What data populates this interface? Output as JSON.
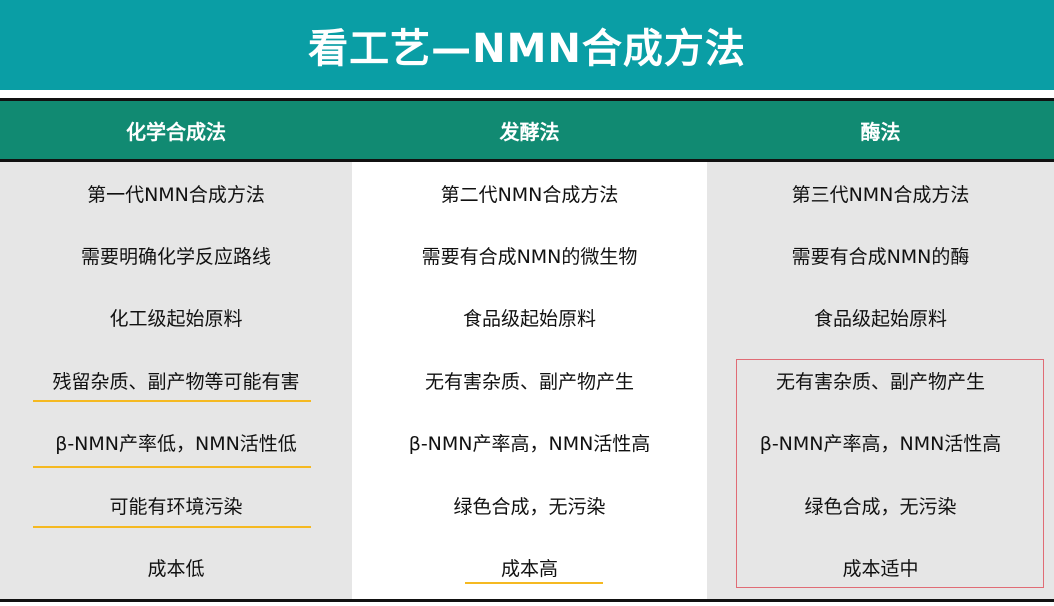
{
  "title": "看工艺—NMN合成方法",
  "columns": [
    {
      "header": "化学合成法",
      "rows": [
        "第一代NMN合成方法",
        "需要明确化学反应路线",
        "化工级起始原料",
        "残留杂质、副产物等可能有害",
        "β-NMN产率低，NMN活性低",
        "可能有环境污染",
        "成本低"
      ]
    },
    {
      "header": "发酵法",
      "rows": [
        "第二代NMN合成方法",
        "需要有合成NMN的微生物",
        "食品级起始原料",
        "无有害杂质、副产物产生",
        "β-NMN产率高，NMN活性高",
        "绿色合成，无污染",
        "成本高"
      ]
    },
    {
      "header": "酶法",
      "rows": [
        "第三代NMN合成方法",
        "需要有合成NMN的酶",
        "食品级起始原料",
        "无有害杂质、副产物产生",
        "β-NMN产率高，NMN活性高",
        "绿色合成，无污染",
        "成本适中"
      ]
    }
  ],
  "colors": {
    "title_bg": "#0a9ea5",
    "header_bg": "#118a72",
    "shaded_col_bg": "#e6e6e6",
    "underline": "#f5b921",
    "highlight_border": "#e06c75"
  }
}
